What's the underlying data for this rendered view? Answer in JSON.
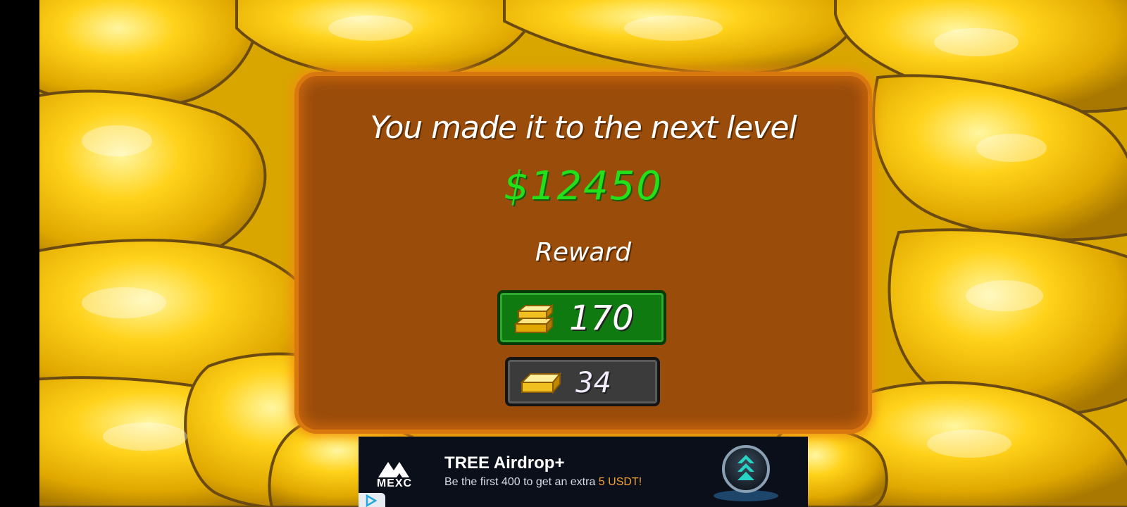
{
  "dialog": {
    "title": "You made it to the next level",
    "money": "$12450",
    "reward_label": "Reward"
  },
  "rewards": [
    {
      "value": "170",
      "icon": "gold-bars-stack-icon",
      "color": "#0f7a0f"
    },
    {
      "value": "34",
      "icon": "gold-bar-icon",
      "color": "#3b3b3b"
    }
  ],
  "ad": {
    "brand": "MEXC",
    "title": "TREE Airdrop+",
    "subtitle_prefix": "Be the first 400 to get an extra ",
    "subtitle_highlight": "5 USDT!",
    "logo_icon": "mexc-logo-icon",
    "coin_icon": "tree-token-coin-icon",
    "choices_icon": "ad-choices-icon"
  },
  "colors": {
    "background_gold": "#e8b800",
    "dialog_brown": "#9a4c0a",
    "money_green": "#22e019"
  }
}
